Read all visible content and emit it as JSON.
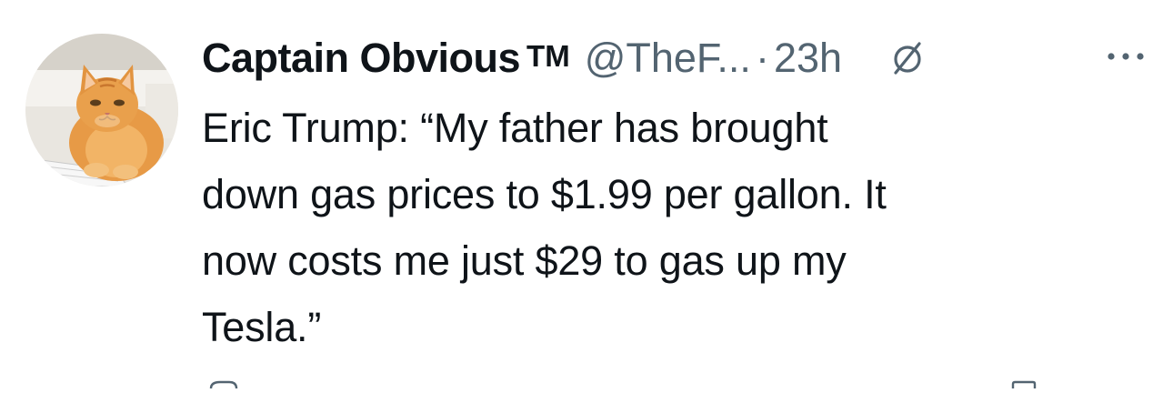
{
  "tweet": {
    "author": {
      "display_name": "Captain Obvious",
      "badge": "TM",
      "handle": "@TheF...",
      "avatar_icon": "orange-cat-avatar"
    },
    "separator": "·",
    "timestamp": "23h",
    "text_lines": [
      "Eric Trump: “My father has brought",
      "down gas prices to $1.99 per gallon. It",
      "now costs me just $29 to gas up my",
      "Tesla.”"
    ]
  },
  "icons": {
    "grok": "grok-icon",
    "more": "more-options-icon"
  },
  "colors": {
    "text_primary": "#0f1419",
    "text_secondary": "#536471"
  }
}
